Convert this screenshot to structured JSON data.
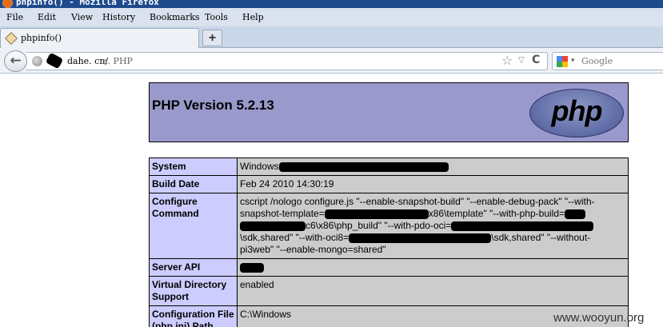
{
  "window": {
    "title": "phpinfo() - Mozilla Firefox"
  },
  "menu": [
    "File",
    "Edit",
    "View",
    "History",
    "Bookmarks",
    "Tools",
    "Help"
  ],
  "tabs": [
    {
      "label": "phpinfo()"
    }
  ],
  "new_tab_label": "+",
  "nav": {
    "back_glyph": "←",
    "url_host": "dahe. cn/",
    "url_path": "a. PHP",
    "star_glyph": "☆",
    "dropdown_glyph": "▽",
    "reload_glyph": "C",
    "search_placeholder": "Google",
    "search_dropdown_glyph": "▾"
  },
  "icons": {
    "firefox": "firefox-icon",
    "tab": "php-page-icon",
    "globe": "globe-icon",
    "search_engine": "google-icon"
  },
  "page": {
    "heading": "PHP Version 5.2.13",
    "logo_text": "php",
    "rows": [
      {
        "label": "System",
        "value": "Windows"
      },
      {
        "label": "Build Date",
        "value": "Feb 24 2010 14:30:19"
      },
      {
        "label": "Configure Command",
        "value_line1": "cscript /nologo configure.js \"--enable-snapshot-build\" \"--enable-debug-pack\" \"--with-",
        "value_line2a": "snapshot-template=",
        "value_line2b": "x86\\template\" \"--with-php-build=",
        "value_line3a": "c6\\x86\\php_build\" \"--with-pdo-oci=",
        "value_line4a": "\\sdk,shared\" \"--with-oci8=",
        "value_line4b": "\\sdk,shared\" \"--without-",
        "value_line5": "pi3web\" \"--enable-mongo=shared\""
      },
      {
        "label": "Server API",
        "value": ""
      },
      {
        "label": "Virtual Directory Support",
        "value": "enabled"
      },
      {
        "label": "Configuration File (php.ini) Path",
        "value": "C:\\Windows"
      }
    ]
  },
  "watermark": "www.wooyun.org",
  "colors": {
    "header_bg": "#9999cc",
    "label_bg": "#ccccff",
    "value_bg": "#cccccc",
    "titlebar": "#1d4a8c"
  }
}
